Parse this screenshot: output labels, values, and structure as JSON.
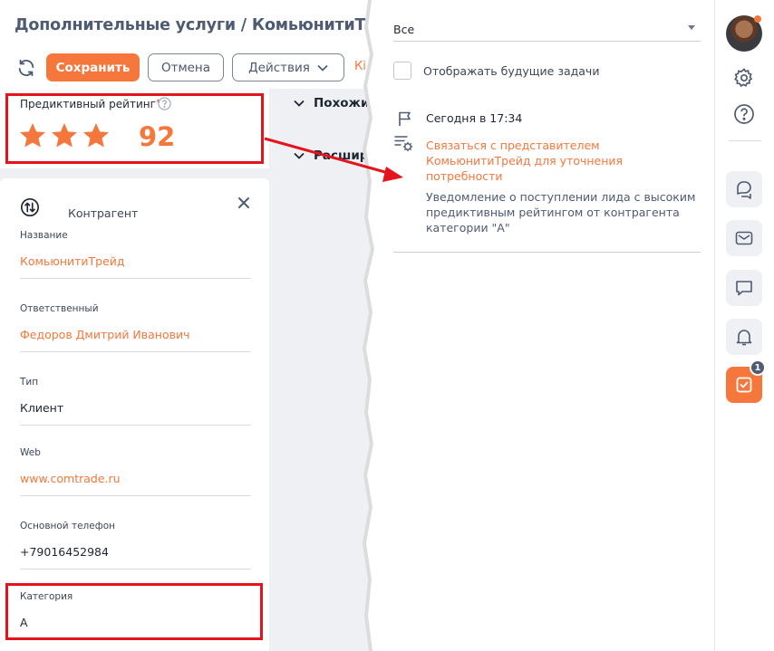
{
  "header": {
    "title": "Дополнительные услуги / КомьюнитиТрейд",
    "save_label": "Сохранить",
    "cancel_label": "Отмена",
    "actions_label": "Действия",
    "overflow_text": "Кі"
  },
  "rating": {
    "label": "Предиктивный рейтинг",
    "required_mark": "*",
    "stars": 3,
    "value": "92"
  },
  "sections": {
    "similar": "Похожи",
    "extended": "Расшир"
  },
  "contractor": {
    "title": "Контрагент",
    "fields": [
      {
        "label": "Название",
        "value": "КомьюнитиТрейд"
      },
      {
        "label": "Ответственный",
        "value": "Федоров Дмитрий Иванович"
      },
      {
        "label": "Тип",
        "value": "Клиент"
      },
      {
        "label": "Web",
        "value": "www.comtrade.ru"
      },
      {
        "label": "Основной телефон",
        "value": "+79016452984"
      },
      {
        "label": "Категория",
        "value": "А"
      }
    ]
  },
  "tasks": {
    "filter": "Все",
    "show_future_label": "Отображать будущие задачи",
    "item": {
      "time": "Сегодня в 17:34",
      "title": "Связаться с представителем КомьюнитиТрейд для уточнения потребности",
      "description": "Уведомление о поступлении лида с высоким предиктивным рейтингом от контрагента категории \"А\""
    }
  },
  "sidebar": {
    "tasks_badge": "1"
  },
  "colors": {
    "accent": "#f5773c",
    "highlight": "#e3141c",
    "text_muted": "#4e5b73"
  }
}
